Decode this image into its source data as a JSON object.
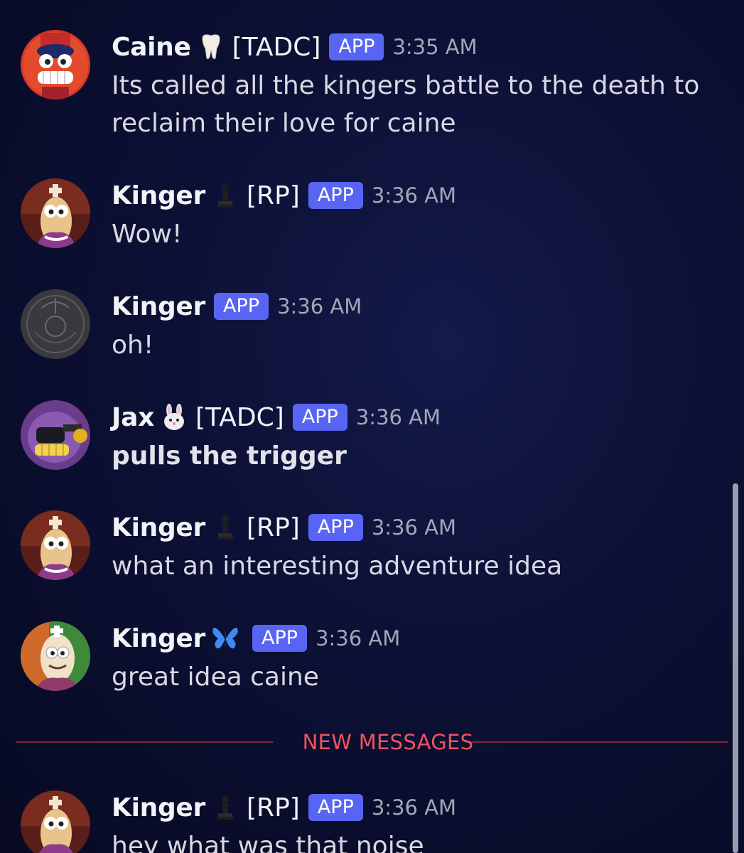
{
  "messages": [
    {
      "name": "Caine",
      "emoji": "tooth-icon",
      "tag": "[TADC]",
      "badge": "APP",
      "time": "3:35 AM",
      "lines": [
        "Its called all the kingers battle to the death to",
        "reclaim their love for caine"
      ]
    },
    {
      "name": "Kinger",
      "emoji": "chess-pawn-icon",
      "tag": "[RP]",
      "badge": "APP",
      "time": "3:36 AM",
      "lines": [
        "Wow!"
      ]
    },
    {
      "name": "Kinger",
      "emoji": "",
      "tag": "",
      "badge": "APP",
      "time": "3:36 AM",
      "lines": [
        "oh!"
      ]
    },
    {
      "name": "Jax",
      "emoji": "rabbit-icon",
      "tag": "[TADC]",
      "badge": "APP",
      "time": "3:36 AM",
      "lines": [
        "pulls the trigger"
      ]
    },
    {
      "name": "Kinger",
      "emoji": "chess-pawn-icon",
      "tag": "[RP]",
      "badge": "APP",
      "time": "3:36 AM",
      "lines": [
        "what an interesting adventure idea"
      ]
    },
    {
      "name": "Kinger",
      "emoji": "butterfly-icon",
      "tag": "",
      "badge": "APP",
      "time": "3:36 AM",
      "lines": [
        "great idea caine"
      ]
    },
    {
      "name": "Kinger",
      "emoji": "chess-pawn-icon",
      "tag": "[RP]",
      "badge": "APP",
      "time": "3:36 AM",
      "lines": [
        "hey what was that noise"
      ]
    }
  ],
  "divider": {
    "label": "NEW MESSAGES",
    "color": "#f0545b"
  },
  "colors": {
    "badge": "#5865f2",
    "background": "#0c1035"
  }
}
